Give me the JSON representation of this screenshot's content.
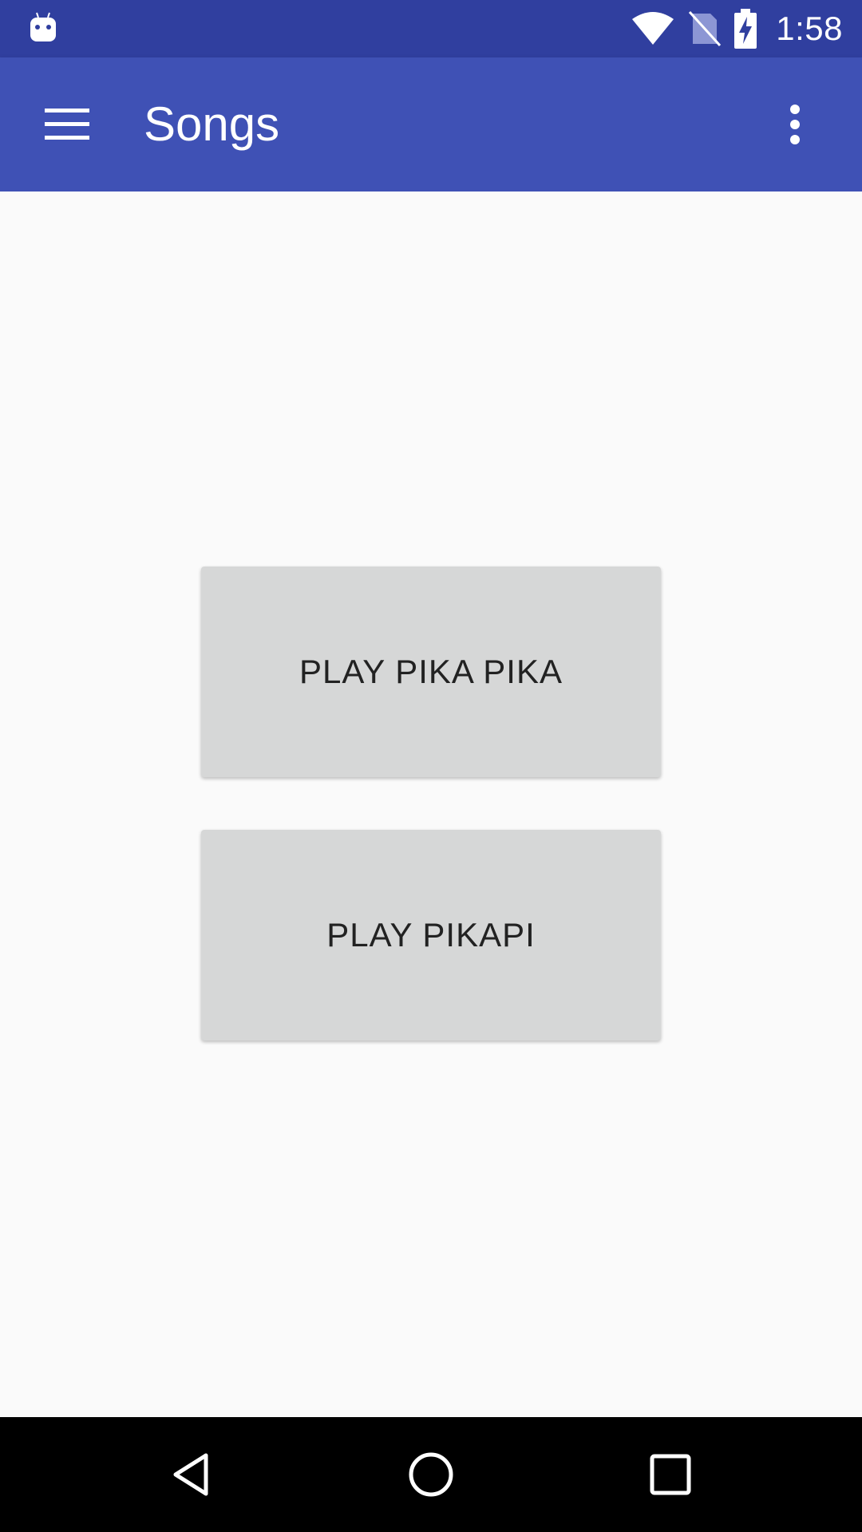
{
  "status_bar": {
    "time": "1:58",
    "icons": [
      "android-debug-icon",
      "wifi-icon",
      "no-sim-icon",
      "battery-charging-icon"
    ]
  },
  "app_bar": {
    "title": "Songs",
    "menu_icon": "hamburger-menu-icon",
    "overflow_icon": "more-vert-icon"
  },
  "main": {
    "buttons": [
      {
        "label": "PLAY PIKA PIKA"
      },
      {
        "label": "PLAY PIKAPI"
      }
    ]
  },
  "nav_bar": {
    "icons": [
      "back-icon",
      "home-icon",
      "recents-icon"
    ]
  },
  "colors": {
    "status_bar": "#303f9f",
    "app_bar": "#3f51b5",
    "background": "#fafafa",
    "button": "#d6d7d7",
    "nav_bar": "#000000"
  }
}
